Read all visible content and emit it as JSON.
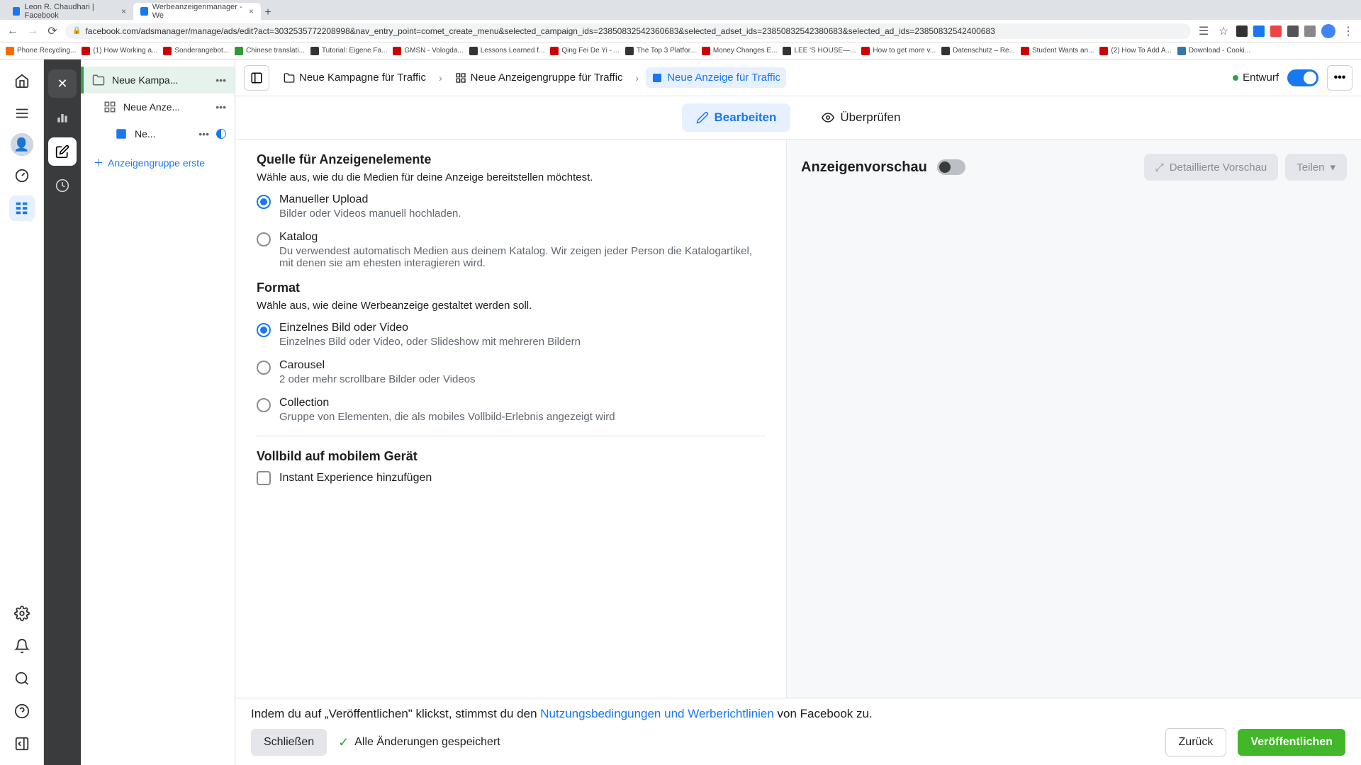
{
  "browser": {
    "tabs": [
      {
        "title": "Leon R. Chaudhari | Facebook"
      },
      {
        "title": "Werbeanzeigenmanager - We"
      }
    ],
    "url": "facebook.com/adsmanager/manage/ads/edit?act=3032535772208998&nav_entry_point=comet_create_menu&selected_campaign_ids=23850832542360683&selected_adset_ids=23850832542380683&selected_ad_ids=23850832542400683",
    "bookmarks": [
      "Phone Recycling...",
      "(1) How Working a...",
      "Sonderangebot...",
      "Chinese translati...",
      "Tutorial: Eigene Fa...",
      "GMSN - Vologda...",
      "Lessons Learned f...",
      "Qing Fei De Yi - ...",
      "The Top 3 Platfor...",
      "Money Changes E...",
      "LEE 'S HOUSE—...",
      "How to get more v...",
      "Datenschutz – Re...",
      "Student Wants an...",
      "(2) How To Add A...",
      "Download - Cooki..."
    ]
  },
  "tree": {
    "campaign": "Neue Kampa...",
    "adset": "Neue Anze...",
    "ad": "Ne...",
    "add_group": "Anzeigengruppe erste"
  },
  "breadcrumb": {
    "campaign": "Neue Kampagne für Traffic",
    "adset": "Neue Anzeigengruppe für Traffic",
    "ad": "Neue Anzeige für Traffic"
  },
  "status": {
    "draft": "Entwurf"
  },
  "tabs": {
    "edit": "Bearbeiten",
    "review": "Überprüfen"
  },
  "source": {
    "heading": "Quelle für Anzeigenelemente",
    "subheading": "Wähle aus, wie du die Medien für deine Anzeige bereitstellen möchtest.",
    "manual_title": "Manueller Upload",
    "manual_desc": "Bilder oder Videos manuell hochladen.",
    "catalog_title": "Katalog",
    "catalog_desc": "Du verwendest automatisch Medien aus deinem Katalog. Wir zeigen jeder Person die Katalogartikel, mit denen sie am ehesten interagieren wird."
  },
  "format": {
    "heading": "Format",
    "subheading": "Wähle aus, wie deine Werbeanzeige gestaltet werden soll.",
    "single_title": "Einzelnes Bild oder Video",
    "single_desc": "Einzelnes Bild oder Video, oder Slideshow mit mehreren Bildern",
    "carousel_title": "Carousel",
    "carousel_desc": "2 oder mehr scrollbare Bilder oder Videos",
    "collection_title": "Collection",
    "collection_desc": "Gruppe von Elementen, die als mobiles Vollbild-Erlebnis angezeigt wird"
  },
  "fullscreen": {
    "heading": "Vollbild auf mobilem Gerät",
    "instant": "Instant Experience hinzufügen"
  },
  "preview": {
    "title": "Anzeigenvorschau",
    "detailed": "Detaillierte Vorschau",
    "share": "Teilen"
  },
  "footer": {
    "consent_prefix": "Indem du auf „Veröffentlichen\" klickst, stimmst du den ",
    "consent_link": "Nutzungsbedingungen und Werberichtlinien",
    "consent_suffix": " von Facebook zu.",
    "close": "Schließen",
    "saved": "Alle Änderungen gespeichert",
    "back": "Zurück",
    "publish": "Veröffentlichen"
  }
}
